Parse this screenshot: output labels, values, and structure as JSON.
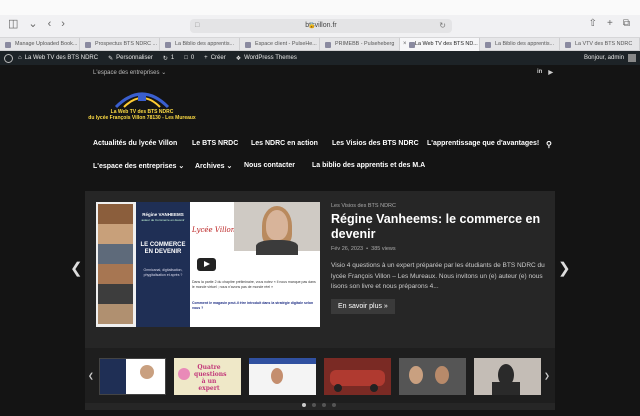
{
  "browser": {
    "url": "btsvillon.fr",
    "tabs": [
      {
        "label": "Manage Uploaded Book..."
      },
      {
        "label": "Prospectus BTS NDRC ..."
      },
      {
        "label": "La Biblio des apprentis..."
      },
      {
        "label": "Espace client - PulseHe..."
      },
      {
        "label": "PRIMEBB - Pulseheberg"
      },
      {
        "label": "La Web TV des BTS ND..."
      },
      {
        "label": "La Biblio des apprentis..."
      },
      {
        "label": "La VTV des BTS NDRC"
      }
    ],
    "active_tab": 5
  },
  "adminbar": {
    "site_name": "La Web TV des BTS NDRC",
    "customize": "Personnaliser",
    "updates_count": "1",
    "comments_count": "0",
    "new": "Créer",
    "themes": "WordPress Themes",
    "greeting": "Bonjour, admin"
  },
  "site": {
    "utility": "L'espace des entreprises",
    "social": [
      "in",
      "▶"
    ],
    "logo_line1": "La Web TV des BTS NDRC",
    "logo_line2": "du lycée François Villon 78130 - Les Mureaux",
    "nav_row1": [
      {
        "label": "Actualités du lycée Villon"
      },
      {
        "label": "Le BTS NRDC"
      },
      {
        "label": "Les NDRC en action"
      },
      {
        "label": "Les Visios des BTS NDRC"
      },
      {
        "label": "L'apprentissage que d'avantages!"
      }
    ],
    "nav_row2": [
      {
        "label": "L'espace des entreprises"
      },
      {
        "label": "Archives"
      },
      {
        "label": "Nous contacter"
      },
      {
        "label": "La biblio des apprentis et des M.A"
      }
    ]
  },
  "featured": {
    "category": "Les Visios des BTS NDRC",
    "title": "Régine Vanheems: le commerce en devenir",
    "date": "Fév 26, 2023",
    "views": "385 views",
    "excerpt": "Visio 4 questions à un expert préparée par les étudiants de BTS NDRC du lycée François Villon – Les Mureaux. Nous invitons un (e) auteur (e) nous lisons son livre et nous préparons 4...",
    "more": "En savoir plus »",
    "thumb": {
      "name": "Régine VANHEEMS",
      "subtitle": "auteur de Commerce en devenir",
      "card_title": "LE COMMERCE EN DEVENIR",
      "card_desc": "Omnicanal, digitalisation, phygitalisation et après ?",
      "brand": "Lycée Villon",
      "q1": "Dans la partie 2 du chapitre préliminaire, vous notez « Il nous manque pas dans le monde virtuel ; nous n'avons pas de monde réel »",
      "q2": "Comment le magasin peut-il être introduit dans la stratégie digitale selon vous ?"
    }
  },
  "carousel": {
    "active_dot": 0,
    "dot_count": 4,
    "thumb2_text": "Quatre questions à un expert"
  }
}
